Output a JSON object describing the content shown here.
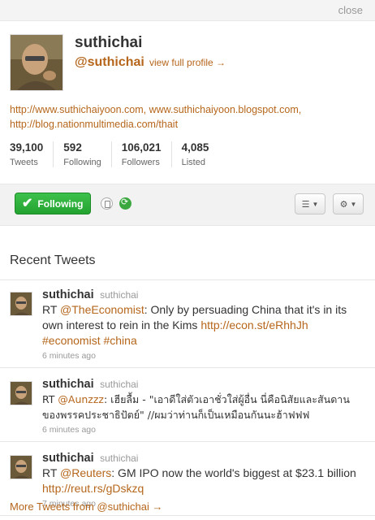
{
  "close_label": "close",
  "profile": {
    "name": "suthichai",
    "handle": "@suthichai",
    "view_full_profile": "view full profile →",
    "urls_line1": "http://www.suthichaiyoon.com, www.suthichaiyoon.blogspot.com,",
    "urls_line2": "http://blog.nationmultimedia.com/thait",
    "stats": [
      {
        "value": "39,100",
        "label": "Tweets"
      },
      {
        "value": "592",
        "label": "Following"
      },
      {
        "value": "106,021",
        "label": "Followers"
      },
      {
        "value": "4,085",
        "label": "Listed"
      }
    ]
  },
  "actions": {
    "following_label": "Following",
    "list_icon": "list-icon",
    "gear_icon": "gear-icon",
    "accent_color": "#2fb13c"
  },
  "recent_tweets_title": "Recent Tweets",
  "tweets": [
    {
      "name": "suthichai",
      "handle": "suthichai",
      "prefix": "RT ",
      "mention": "@TheEconomist",
      "text": ": Only by persuading China that it's in its own interest to rein in the Kims ",
      "link": "http://econ.st/eRhhJh",
      "link2": "#economist",
      "link3": "#china",
      "time": "6 minutes ago"
    },
    {
      "name": "suthichai",
      "handle": "suthichai",
      "prefix": "RT ",
      "mention": "@Aunzzz",
      "text": ": เฮียลื้ม - \"เอาดีใส่ตัวเอาชั่วใส่ผู้อื่น นี่คือนิสัยและสันดานของพรรคประชาธิปัตย์\" //ผมว่าท่านก็เป็นเหมือนกันนะฮ้าฟฟฟ",
      "time": "6 minutes ago"
    },
    {
      "name": "suthichai",
      "handle": "suthichai",
      "prefix": "RT ",
      "mention": "@Reuters",
      "text": ": GM IPO now the world's biggest at $23.1 billion ",
      "link": "http://reut.rs/gDskzq",
      "time": "7 minutes ago"
    }
  ],
  "more_tweets": "More Tweets from @suthichai →"
}
